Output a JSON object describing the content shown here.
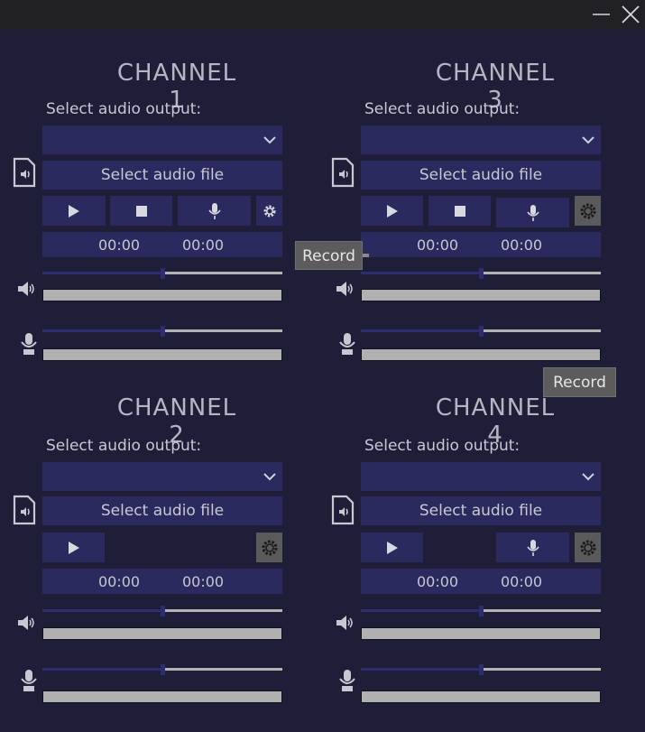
{
  "window": {
    "controls": [
      "minimize",
      "close"
    ]
  },
  "channels": [
    {
      "title": "CHANNEL 1",
      "output_label": "Select audio output:",
      "output_value": "",
      "file_button": "Select audio file",
      "buttons": [
        "play",
        "stop",
        "record",
        "settings"
      ],
      "time_current": "00:00",
      "time_total": "00:00",
      "volume": 0.5,
      "mic_volume": 0.5
    },
    {
      "title": "CHANNEL 3",
      "output_label": "Select audio output:",
      "output_value": "",
      "file_button": "Select audio file",
      "buttons": [
        "play",
        "stop",
        "record",
        "settings"
      ],
      "time_current": "00:00",
      "time_total": "00:00",
      "volume": 0.5,
      "mic_volume": 0.5
    },
    {
      "title": "CHANNEL 2",
      "output_label": "Select audio output:",
      "output_value": "",
      "file_button": "Select audio file",
      "buttons": [
        "play",
        "settings"
      ],
      "time_current": "00:00",
      "time_total": "00:00",
      "volume": 0.5,
      "mic_volume": 0.5
    },
    {
      "title": "CHANNEL 4",
      "output_label": "Select audio output:",
      "output_value": "",
      "file_button": "Select audio file",
      "buttons": [
        "play",
        "record",
        "settings"
      ],
      "time_current": "00:00",
      "time_total": "00:00",
      "volume": 0.5,
      "mic_volume": 0.5
    }
  ],
  "tooltips": [
    "Record",
    "Record"
  ],
  "colors": {
    "background": "#1e1e39",
    "panel": "#2a2a5e",
    "accent": "#2d2d70",
    "meter": "#b0b0b0",
    "titlebar": "#202025"
  }
}
